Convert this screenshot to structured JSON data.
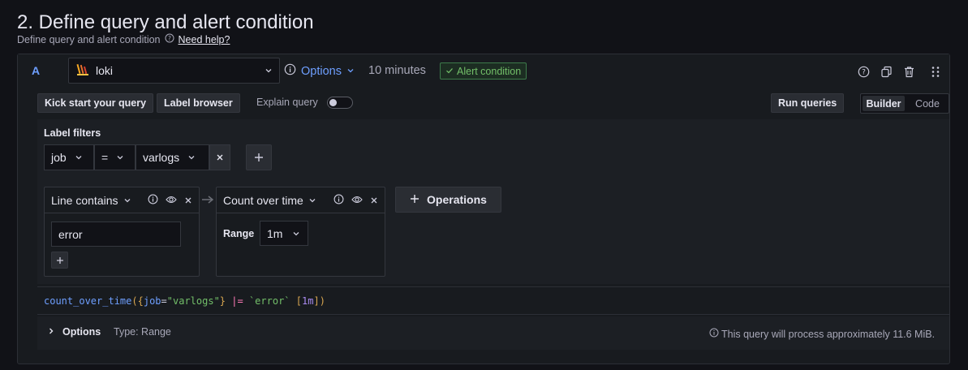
{
  "section": {
    "title": "2. Define query and alert condition",
    "subtitle": "Define query and alert condition",
    "help_link": "Need help?"
  },
  "query": {
    "ref_id": "A",
    "datasource": "loki",
    "options_label": "Options",
    "time_range": "10 minutes",
    "alert_condition": "Alert condition"
  },
  "toolbar": {
    "kick_start": "Kick start your query",
    "label_browser": "Label browser",
    "explain_query": "Explain query",
    "run_queries": "Run queries",
    "mode_builder": "Builder",
    "mode_code": "Code"
  },
  "label_filters": {
    "title": "Label filters",
    "filters": [
      {
        "label": "job",
        "operator": "=",
        "value": "varlogs"
      }
    ]
  },
  "operations": [
    {
      "name": "Line contains",
      "input_value": "error"
    },
    {
      "name": "Count over time",
      "param_label": "Range",
      "param_value": "1m"
    }
  ],
  "operations_button": "Operations",
  "code_preview": {
    "fn": "count_over_time",
    "open_paren": "(",
    "open_brace": "{",
    "key": "job",
    "eq": "=",
    "val": "\"varlogs\"",
    "close_brace": "}",
    "pipe_op": "|=",
    "line_filter": "`error`",
    "range_open": "[",
    "range_val": "1m",
    "range_close": "]",
    "close_paren": ")"
  },
  "options_row": {
    "label": "Options",
    "type": "Type: Range",
    "estimate": "This query will process approximately 11.6 MiB."
  },
  "colors": {
    "accent": "#6e9fff",
    "success": "#73bf69",
    "background": "#111217"
  }
}
